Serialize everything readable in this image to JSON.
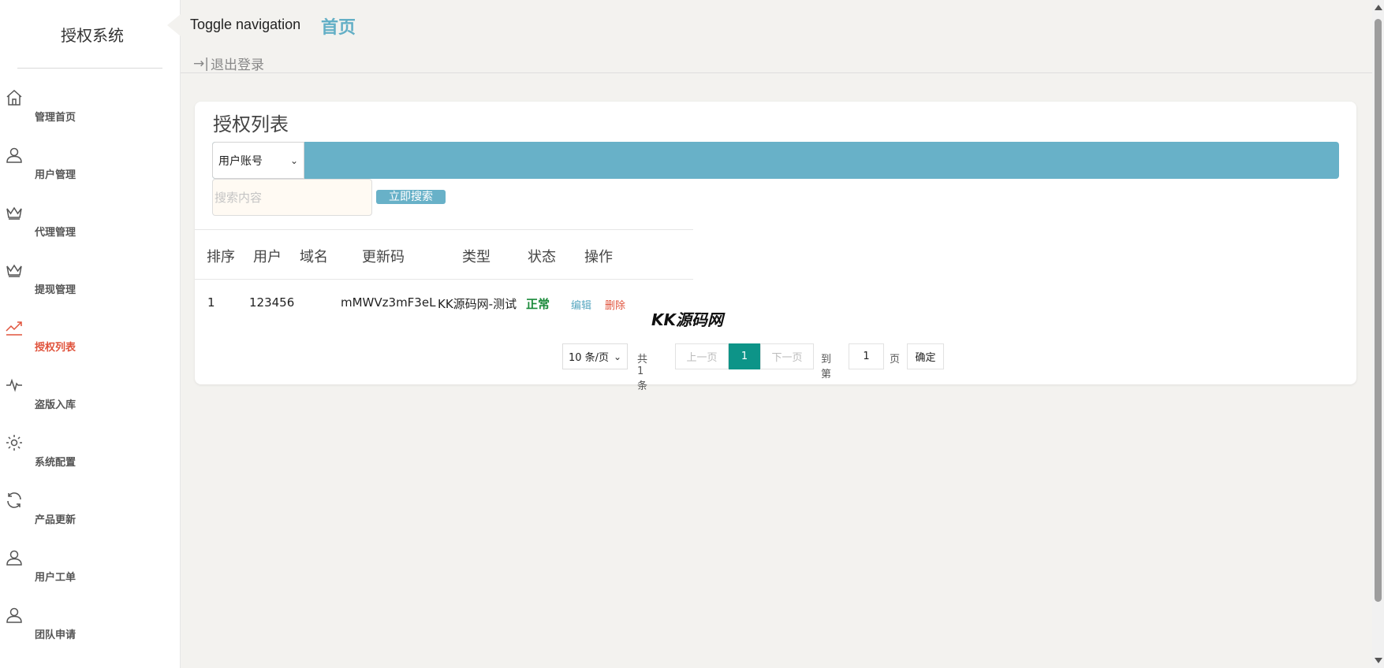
{
  "sidebar": {
    "brand": "授权系统",
    "items": [
      {
        "label": "管理首页",
        "icon": "home-icon"
      },
      {
        "label": "用户管理",
        "icon": "user-icon"
      },
      {
        "label": "代理管理",
        "icon": "crown-icon"
      },
      {
        "label": "提现管理",
        "icon": "crown-icon"
      },
      {
        "label": "授权列表",
        "icon": "trend-icon",
        "active": true
      },
      {
        "label": "盗版入库",
        "icon": "pulse-icon"
      },
      {
        "label": "系统配置",
        "icon": "gear-icon"
      },
      {
        "label": "产品更新",
        "icon": "refresh-icon"
      },
      {
        "label": "用户工单",
        "icon": "user-icon"
      },
      {
        "label": "团队申请",
        "icon": "user-icon"
      }
    ]
  },
  "header": {
    "toggle": "Toggle navigation",
    "home": "首页",
    "logout": "退出登录"
  },
  "main": {
    "title": "授权列表",
    "search": {
      "select_value": "用户账号",
      "placeholder": "搜索内容",
      "button": "立即搜索"
    },
    "table": {
      "headers": [
        "排序",
        "用户",
        "域名",
        "更新码",
        "类型",
        "状态",
        "操作"
      ],
      "rows": [
        {
          "rank": "1",
          "user": "123456",
          "domain": "",
          "code": "mMWVz3mF3eL",
          "type": "KK源码网-测试",
          "status": "正常",
          "edit": "编辑",
          "delete": "删除"
        }
      ]
    },
    "watermark": "KK源码网",
    "pagination": {
      "per_page": "10 条/页",
      "total": "共 1 条",
      "prev": "上一页",
      "current": "1",
      "next": "下一页",
      "goto": "到第",
      "goto_value": "1",
      "page_unit": "页",
      "confirm": "确定"
    }
  },
  "colors": {
    "accent": "#68b1c8",
    "active_nav": "#e0533c",
    "status_ok": "#1a8a3a",
    "pager_current": "#0d9488"
  }
}
